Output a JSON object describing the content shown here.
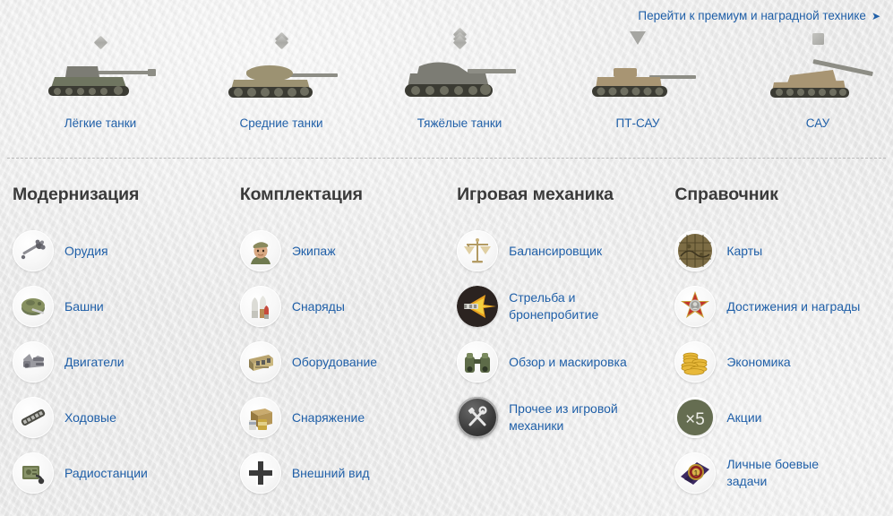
{
  "header": {
    "premium_link": "Перейти к премиум и наградной технике",
    "arrow_icon": "arrow-right-icon"
  },
  "tank_classes": [
    {
      "label": "Лёгкие танки",
      "class_icon": "one-diamond-icon",
      "tank_icon": "light-tank-icon"
    },
    {
      "label": "Средние танки",
      "class_icon": "two-diamonds-icon",
      "tank_icon": "medium-tank-icon"
    },
    {
      "label": "Тяжёлые танки",
      "class_icon": "three-diamonds-icon",
      "tank_icon": "heavy-tank-icon"
    },
    {
      "label": "ПТ-САУ",
      "class_icon": "triangle-down-icon",
      "tank_icon": "tank-destroyer-icon"
    },
    {
      "label": "САУ",
      "class_icon": "square-icon",
      "tank_icon": "spg-icon"
    }
  ],
  "columns": [
    {
      "title": "Модернизация",
      "items": [
        {
          "label": "Орудия",
          "icon": "gun-icon"
        },
        {
          "label": "Башни",
          "icon": "turret-icon"
        },
        {
          "label": "Двигатели",
          "icon": "engine-icon"
        },
        {
          "label": "Ходовые",
          "icon": "suspension-icon"
        },
        {
          "label": "Радиостанции",
          "icon": "radio-icon"
        }
      ]
    },
    {
      "title": "Комплектация",
      "items": [
        {
          "label": "Экипаж",
          "icon": "crew-icon"
        },
        {
          "label": "Снаряды",
          "icon": "shells-icon"
        },
        {
          "label": "Оборудование",
          "icon": "equipment-icon"
        },
        {
          "label": "Снаряжение",
          "icon": "consumables-icon"
        },
        {
          "label": "Внешний вид",
          "icon": "emblem-cross-icon"
        }
      ]
    },
    {
      "title": "Игровая механика",
      "items": [
        {
          "label": "Балансировщик",
          "icon": "scales-icon"
        },
        {
          "label": "Стрельба и бронепробитие",
          "icon": "penetration-icon"
        },
        {
          "label": "Обзор и маскировка",
          "icon": "binoculars-icon"
        },
        {
          "label": "Прочее из игровой механики",
          "icon": "tools-icon"
        }
      ]
    },
    {
      "title": "Справочник",
      "items": [
        {
          "label": "Карты",
          "icon": "map-icon"
        },
        {
          "label": "Достижения и награды",
          "icon": "medal-icon"
        },
        {
          "label": "Экономика",
          "icon": "coins-icon"
        },
        {
          "label": "Акции",
          "icon": "x5-multiplier-icon"
        },
        {
          "label": "Личные боевые задачи",
          "icon": "personal-missions-icon"
        }
      ]
    }
  ],
  "colors": {
    "link": "#1f5fa8",
    "heading": "#3a3a3a",
    "background": "#ececec",
    "divider": "#b9b9b9"
  }
}
